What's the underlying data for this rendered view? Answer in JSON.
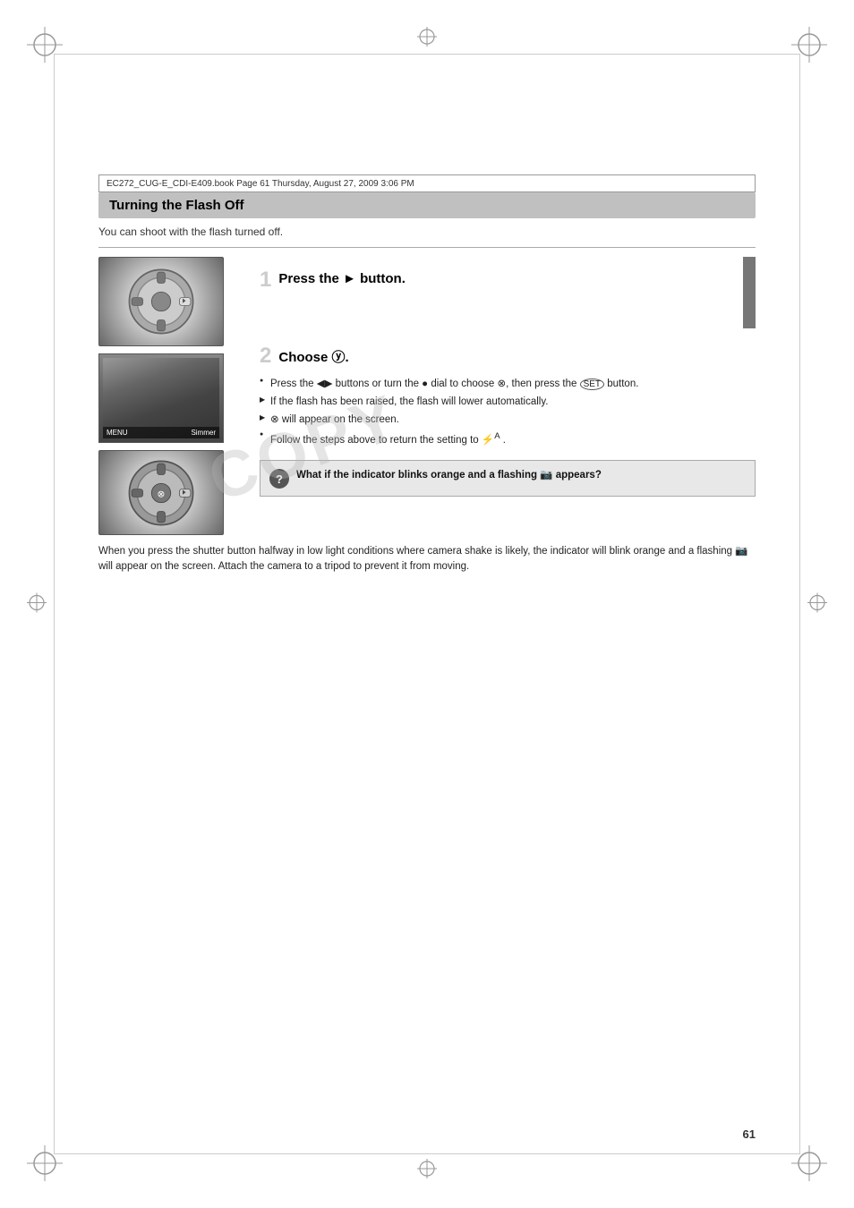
{
  "page": {
    "number": "61",
    "file_info": "EC272_CUG-E_CDI-E409.book  Page 61  Thursday, August 27, 2009  3:06 PM"
  },
  "section": {
    "title": "Turning the Flash Off",
    "intro": "You can shoot with the flash turned off."
  },
  "step1": {
    "number": "1",
    "title": "Press the ► button."
  },
  "step2": {
    "number": "2",
    "title": "Choose ⓨ.",
    "bullets": [
      "Press the ◄► buttons or turn the ● dial to choose ⓨ, then press the � button.",
      "If the flash has been raised, the flash will lower automatically.",
      "ⓨ will appear on the screen.",
      "Follow the steps above to return the setting to ⚡ᴮ ."
    ],
    "bullet_types": [
      "circle",
      "arrow",
      "arrow",
      "circle"
    ]
  },
  "question_box": {
    "icon": "?",
    "text": "What if the indicator blinks orange and a flashing 📷 appears?"
  },
  "answer": {
    "text": "When you press the shutter button halfway in low light conditions where camera shake is likely, the indicator will blink orange and a flashing 📷 will appear on the screen. Attach the camera to a tripod to prevent it from moving."
  },
  "watermark": "COPY"
}
